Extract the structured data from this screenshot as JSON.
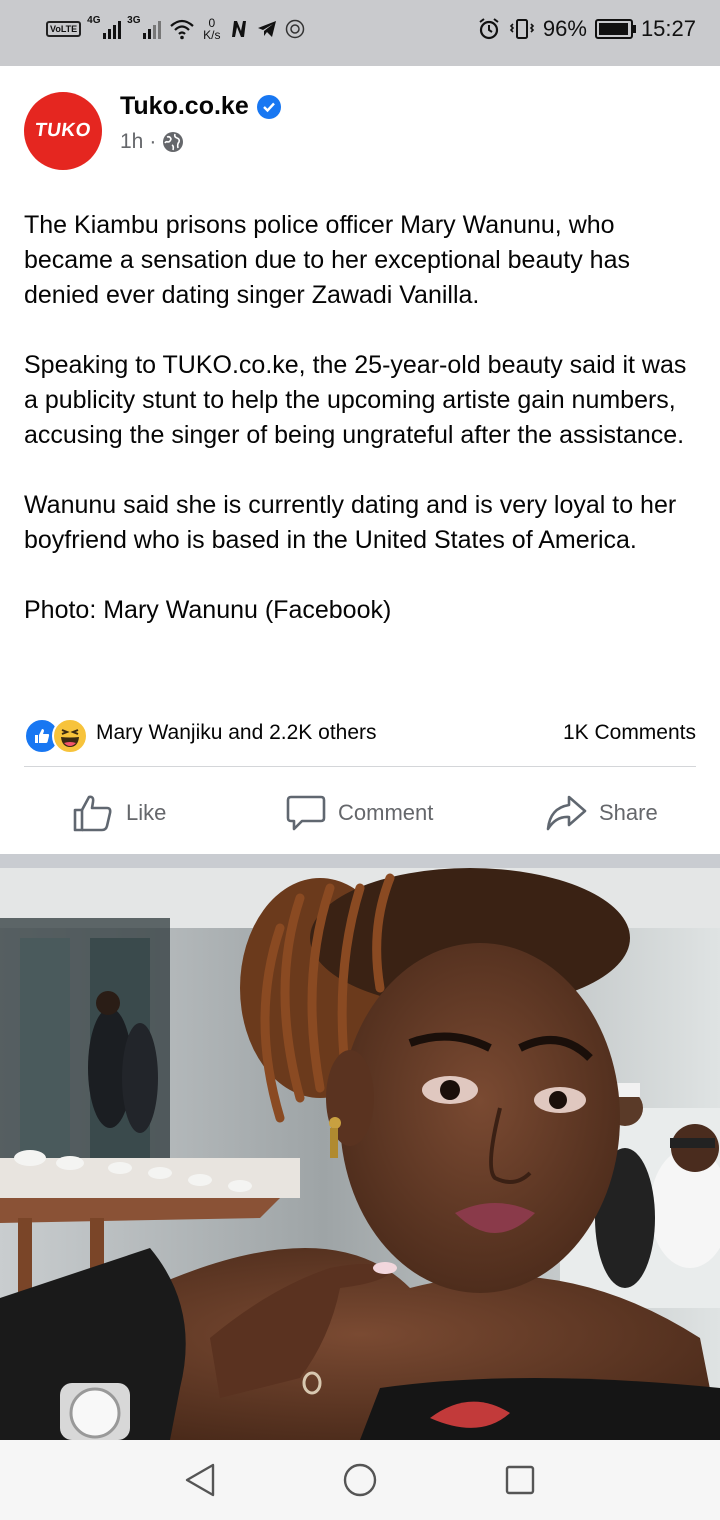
{
  "status_bar": {
    "volte": "VoLTE",
    "network_1": "4G",
    "network_2": "3G",
    "speed_value": "0",
    "speed_unit": "K/s",
    "battery": "96%",
    "battery_level": 0.96,
    "time": "15:27"
  },
  "post": {
    "page_name": "Tuko.co.ke",
    "logo_text": "TUKO",
    "time_ago": "1h",
    "separator": "·",
    "paragraphs": [
      "The Kiambu prisons police officer Mary Wanunu, who became a sensation due to her exceptional beauty has denied ever dating singer Zawadi Vanilla.",
      "Speaking to TUKO.co.ke, the 25-year-old beauty said it was a publicity stunt to help the upcoming artiste gain numbers, accusing the singer of being ungrateful after the assistance.",
      "Wanunu said she is currently dating and is very loyal to her boyfriend who is based in the United States of America.",
      "Photo: Mary Wanunu (Facebook)"
    ],
    "reactions_text": "Mary Wanjiku and 2.2K others",
    "comments_count": "1K Comments"
  },
  "actions": {
    "like": "Like",
    "comment": "Comment",
    "share": "Share"
  },
  "colors": {
    "brand_red": "#e52620",
    "facebook_blue": "#1877f2",
    "secondary_text": "#65676b",
    "status_bar_bg": "#c9cacd"
  }
}
